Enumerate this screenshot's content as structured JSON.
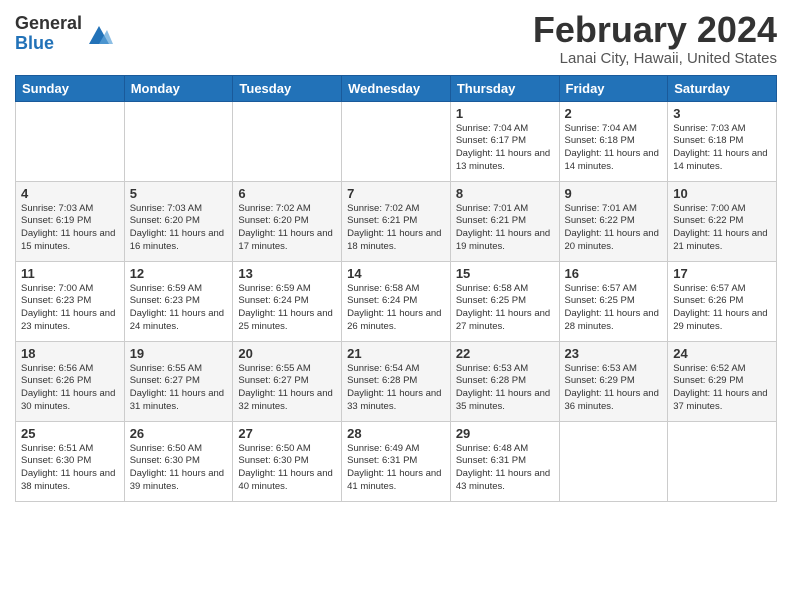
{
  "header": {
    "logo_general": "General",
    "logo_blue": "Blue",
    "main_title": "February 2024",
    "subtitle": "Lanai City, Hawaii, United States"
  },
  "calendar": {
    "weekdays": [
      "Sunday",
      "Monday",
      "Tuesday",
      "Wednesday",
      "Thursday",
      "Friday",
      "Saturday"
    ],
    "weeks": [
      [
        {
          "day": "",
          "info": ""
        },
        {
          "day": "",
          "info": ""
        },
        {
          "day": "",
          "info": ""
        },
        {
          "day": "",
          "info": ""
        },
        {
          "day": "1",
          "info": "Sunrise: 7:04 AM\nSunset: 6:17 PM\nDaylight: 11 hours\nand 13 minutes."
        },
        {
          "day": "2",
          "info": "Sunrise: 7:04 AM\nSunset: 6:18 PM\nDaylight: 11 hours\nand 14 minutes."
        },
        {
          "day": "3",
          "info": "Sunrise: 7:03 AM\nSunset: 6:18 PM\nDaylight: 11 hours\nand 14 minutes."
        }
      ],
      [
        {
          "day": "4",
          "info": "Sunrise: 7:03 AM\nSunset: 6:19 PM\nDaylight: 11 hours\nand 15 minutes."
        },
        {
          "day": "5",
          "info": "Sunrise: 7:03 AM\nSunset: 6:20 PM\nDaylight: 11 hours\nand 16 minutes."
        },
        {
          "day": "6",
          "info": "Sunrise: 7:02 AM\nSunset: 6:20 PM\nDaylight: 11 hours\nand 17 minutes."
        },
        {
          "day": "7",
          "info": "Sunrise: 7:02 AM\nSunset: 6:21 PM\nDaylight: 11 hours\nand 18 minutes."
        },
        {
          "day": "8",
          "info": "Sunrise: 7:01 AM\nSunset: 6:21 PM\nDaylight: 11 hours\nand 19 minutes."
        },
        {
          "day": "9",
          "info": "Sunrise: 7:01 AM\nSunset: 6:22 PM\nDaylight: 11 hours\nand 20 minutes."
        },
        {
          "day": "10",
          "info": "Sunrise: 7:00 AM\nSunset: 6:22 PM\nDaylight: 11 hours\nand 21 minutes."
        }
      ],
      [
        {
          "day": "11",
          "info": "Sunrise: 7:00 AM\nSunset: 6:23 PM\nDaylight: 11 hours\nand 23 minutes."
        },
        {
          "day": "12",
          "info": "Sunrise: 6:59 AM\nSunset: 6:23 PM\nDaylight: 11 hours\nand 24 minutes."
        },
        {
          "day": "13",
          "info": "Sunrise: 6:59 AM\nSunset: 6:24 PM\nDaylight: 11 hours\nand 25 minutes."
        },
        {
          "day": "14",
          "info": "Sunrise: 6:58 AM\nSunset: 6:24 PM\nDaylight: 11 hours\nand 26 minutes."
        },
        {
          "day": "15",
          "info": "Sunrise: 6:58 AM\nSunset: 6:25 PM\nDaylight: 11 hours\nand 27 minutes."
        },
        {
          "day": "16",
          "info": "Sunrise: 6:57 AM\nSunset: 6:25 PM\nDaylight: 11 hours\nand 28 minutes."
        },
        {
          "day": "17",
          "info": "Sunrise: 6:57 AM\nSunset: 6:26 PM\nDaylight: 11 hours\nand 29 minutes."
        }
      ],
      [
        {
          "day": "18",
          "info": "Sunrise: 6:56 AM\nSunset: 6:26 PM\nDaylight: 11 hours\nand 30 minutes."
        },
        {
          "day": "19",
          "info": "Sunrise: 6:55 AM\nSunset: 6:27 PM\nDaylight: 11 hours\nand 31 minutes."
        },
        {
          "day": "20",
          "info": "Sunrise: 6:55 AM\nSunset: 6:27 PM\nDaylight: 11 hours\nand 32 minutes."
        },
        {
          "day": "21",
          "info": "Sunrise: 6:54 AM\nSunset: 6:28 PM\nDaylight: 11 hours\nand 33 minutes."
        },
        {
          "day": "22",
          "info": "Sunrise: 6:53 AM\nSunset: 6:28 PM\nDaylight: 11 hours\nand 35 minutes."
        },
        {
          "day": "23",
          "info": "Sunrise: 6:53 AM\nSunset: 6:29 PM\nDaylight: 11 hours\nand 36 minutes."
        },
        {
          "day": "24",
          "info": "Sunrise: 6:52 AM\nSunset: 6:29 PM\nDaylight: 11 hours\nand 37 minutes."
        }
      ],
      [
        {
          "day": "25",
          "info": "Sunrise: 6:51 AM\nSunset: 6:30 PM\nDaylight: 11 hours\nand 38 minutes."
        },
        {
          "day": "26",
          "info": "Sunrise: 6:50 AM\nSunset: 6:30 PM\nDaylight: 11 hours\nand 39 minutes."
        },
        {
          "day": "27",
          "info": "Sunrise: 6:50 AM\nSunset: 6:30 PM\nDaylight: 11 hours\nand 40 minutes."
        },
        {
          "day": "28",
          "info": "Sunrise: 6:49 AM\nSunset: 6:31 PM\nDaylight: 11 hours\nand 41 minutes."
        },
        {
          "day": "29",
          "info": "Sunrise: 6:48 AM\nSunset: 6:31 PM\nDaylight: 11 hours\nand 43 minutes."
        },
        {
          "day": "",
          "info": ""
        },
        {
          "day": "",
          "info": ""
        }
      ]
    ]
  }
}
